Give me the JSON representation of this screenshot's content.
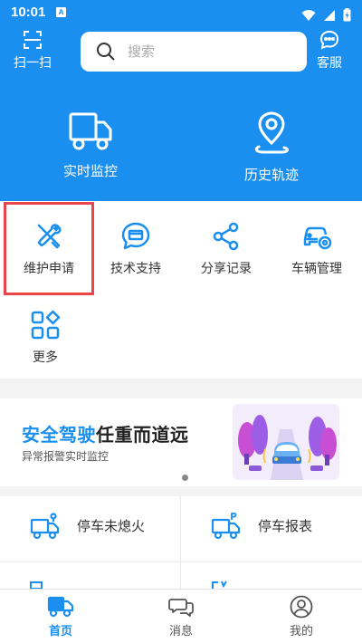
{
  "status_bar": {
    "time": "10:01",
    "sim_label": "A"
  },
  "header": {
    "scan_label": "扫一扫",
    "service_label": "客服",
    "search_placeholder": "搜索"
  },
  "main_actions": [
    {
      "label": "实时监控",
      "icon": "truck-icon"
    },
    {
      "label": "历史轨迹",
      "icon": "location-pin-icon"
    }
  ],
  "grid_items": [
    {
      "label": "维护申请",
      "icon": "tools-icon"
    },
    {
      "label": "技术支持",
      "icon": "chat-support-icon"
    },
    {
      "label": "分享记录",
      "icon": "share-icon"
    },
    {
      "label": "车辆管理",
      "icon": "car-settings-icon"
    },
    {
      "label": "更多",
      "icon": "more-grid-icon"
    }
  ],
  "banner": {
    "title_highlight": "安全驾驶",
    "title_rest": "任重而道远",
    "subtitle": "异常报警实时监控"
  },
  "quick_links": [
    {
      "label": "停车未熄火",
      "icon": "truck-alert-icon"
    },
    {
      "label": "停车报表",
      "icon": "truck-parking-icon"
    }
  ],
  "bottom_nav": [
    {
      "label": "首页",
      "icon": "home-truck-icon",
      "active": true
    },
    {
      "label": "消息",
      "icon": "message-icon",
      "active": false
    },
    {
      "label": "我的",
      "icon": "profile-icon",
      "active": false
    }
  ],
  "colors": {
    "primary": "#1a8ff0",
    "highlight_border": "#e8464b",
    "background": "#f3f3f3"
  }
}
